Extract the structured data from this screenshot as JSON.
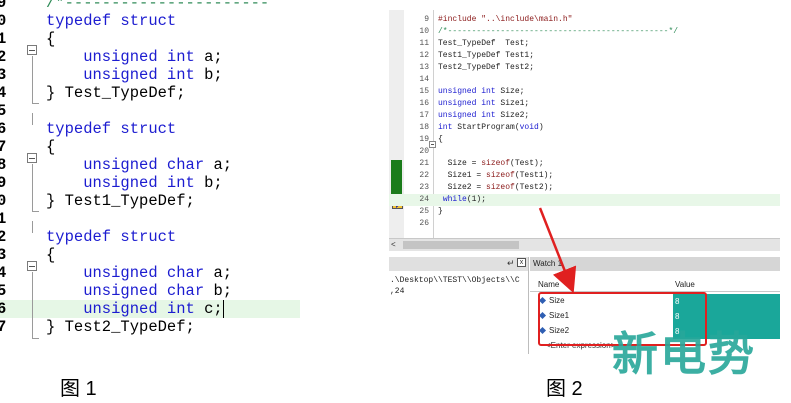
{
  "figure1": {
    "caption": "图 1",
    "lines": [
      {
        "num": "9",
        "tokens": [
          {
            "t": "/*----------------------",
            "c": "cmt"
          }
        ]
      },
      {
        "num": "0",
        "tokens": [
          {
            "t": "typedef struct",
            "c": "kw"
          }
        ]
      },
      {
        "num": "1",
        "tokens": [
          {
            "t": "{",
            "c": "tx"
          }
        ]
      },
      {
        "num": "2",
        "tokens": [
          {
            "t": "    unsigned int",
            "c": "kw"
          },
          {
            "t": " a;",
            "c": "tx"
          }
        ]
      },
      {
        "num": "3",
        "tokens": [
          {
            "t": "    unsigned int",
            "c": "kw"
          },
          {
            "t": " b;",
            "c": "tx"
          }
        ]
      },
      {
        "num": "4",
        "tokens": [
          {
            "t": "} Test_TypeDef;",
            "c": "tx"
          }
        ]
      },
      {
        "num": "5",
        "tokens": [
          {
            "t": "",
            "c": "tx"
          }
        ]
      },
      {
        "num": "6",
        "tokens": [
          {
            "t": "typedef struct",
            "c": "kw"
          }
        ]
      },
      {
        "num": "7",
        "tokens": [
          {
            "t": "{",
            "c": "tx"
          }
        ]
      },
      {
        "num": "8",
        "tokens": [
          {
            "t": "    unsigned char",
            "c": "kw"
          },
          {
            "t": " a;",
            "c": "tx"
          }
        ]
      },
      {
        "num": "9",
        "tokens": [
          {
            "t": "    unsigned int",
            "c": "kw"
          },
          {
            "t": " b;",
            "c": "tx"
          }
        ]
      },
      {
        "num": "0",
        "tokens": [
          {
            "t": "} Test1_TypeDef;",
            "c": "tx"
          }
        ]
      },
      {
        "num": "1",
        "tokens": [
          {
            "t": "",
            "c": "tx"
          }
        ]
      },
      {
        "num": "2",
        "tokens": [
          {
            "t": "typedef struct",
            "c": "kw"
          }
        ]
      },
      {
        "num": "3",
        "tokens": [
          {
            "t": "{",
            "c": "tx"
          }
        ]
      },
      {
        "num": "4",
        "tokens": [
          {
            "t": "    unsigned char",
            "c": "kw"
          },
          {
            "t": " a;",
            "c": "tx"
          }
        ]
      },
      {
        "num": "5",
        "tokens": [
          {
            "t": "    unsigned char",
            "c": "kw"
          },
          {
            "t": " b;",
            "c": "tx"
          }
        ]
      },
      {
        "num": "6",
        "tokens": [
          {
            "t": "    unsigned int",
            "c": "kw"
          },
          {
            "t": " c;",
            "c": "tx"
          }
        ],
        "highlight": true
      },
      {
        "num": "7",
        "tokens": [
          {
            "t": "} Test2_TypeDef;",
            "c": "tx"
          }
        ]
      }
    ]
  },
  "figure2": {
    "caption": "图 2",
    "editor_lines": [
      {
        "num": "9",
        "tokens": [
          {
            "t": "#include ",
            "c": "pp"
          },
          {
            "t": "\"..\\include\\main.h\"",
            "c": "str"
          }
        ]
      },
      {
        "num": "10",
        "tokens": [
          {
            "t": "/*----------------------------------------------*/",
            "c": "cmt"
          }
        ]
      },
      {
        "num": "11",
        "tokens": [
          {
            "t": "Test_TypeDef  Test;",
            "c": "tx"
          }
        ]
      },
      {
        "num": "12",
        "tokens": [
          {
            "t": "Test1_TypeDef Test1;",
            "c": "tx"
          }
        ]
      },
      {
        "num": "13",
        "tokens": [
          {
            "t": "Test2_TypeDef Test2;",
            "c": "tx"
          }
        ]
      },
      {
        "num": "14",
        "tokens": [
          {
            "t": "",
            "c": "tx"
          }
        ]
      },
      {
        "num": "15",
        "tokens": [
          {
            "t": "unsigned int",
            "c": "kw"
          },
          {
            "t": " Size;",
            "c": "tx"
          }
        ]
      },
      {
        "num": "16",
        "tokens": [
          {
            "t": "unsigned int",
            "c": "kw"
          },
          {
            "t": " Size1;",
            "c": "tx"
          }
        ]
      },
      {
        "num": "17",
        "tokens": [
          {
            "t": "unsigned int",
            "c": "kw"
          },
          {
            "t": " Size2;",
            "c": "tx"
          }
        ]
      },
      {
        "num": "18",
        "tokens": [
          {
            "t": "int",
            "c": "kw"
          },
          {
            "t": " StartProgram(",
            "c": "tx"
          },
          {
            "t": "void",
            "c": "kw"
          },
          {
            "t": ")",
            "c": "tx"
          }
        ]
      },
      {
        "num": "19",
        "tokens": [
          {
            "t": "{",
            "c": "tx"
          }
        ]
      },
      {
        "num": "20",
        "tokens": [
          {
            "t": "",
            "c": "tx"
          }
        ]
      },
      {
        "num": "21",
        "tokens": [
          {
            "t": "  Size = ",
            "c": "tx"
          },
          {
            "t": "sizeof",
            "c": "fn"
          },
          {
            "t": "(Test);",
            "c": "tx"
          }
        ]
      },
      {
        "num": "22",
        "tokens": [
          {
            "t": "  Size1 = ",
            "c": "tx"
          },
          {
            "t": "sizeof",
            "c": "fn"
          },
          {
            "t": "(Test1);",
            "c": "tx"
          }
        ]
      },
      {
        "num": "23",
        "tokens": [
          {
            "t": "  Size2 = ",
            "c": "tx"
          },
          {
            "t": "sizeof",
            "c": "fn"
          },
          {
            "t": "(Test2);",
            "c": "tx"
          }
        ]
      },
      {
        "num": "24",
        "tokens": [
          {
            "t": " ",
            "c": "tx"
          },
          {
            "t": "while",
            "c": "kw"
          },
          {
            "t": "(1);",
            "c": "tx"
          }
        ],
        "highlight": true
      },
      {
        "num": "25",
        "tokens": [
          {
            "t": "}",
            "c": "tx"
          }
        ]
      },
      {
        "num": "26",
        "tokens": [
          {
            "t": "",
            "c": "tx"
          }
        ]
      }
    ],
    "scroll_left": "<",
    "output_pane": {
      "pin_icon": "↵",
      "close_label": "x",
      "lines": [
        ".\\Desktop\\\\TEST\\\\Objects\\\\C",
        ",24"
      ]
    },
    "watch": {
      "title": "Watch 1",
      "col_name": "Name",
      "col_value": "Value",
      "rows": [
        {
          "name": "Size",
          "value": "8"
        },
        {
          "name": "Size1",
          "value": "8"
        },
        {
          "name": "Size2",
          "value": "8"
        }
      ],
      "enter_expression": "<Enter expression>"
    }
  },
  "watermark": "新电势",
  "colors": {
    "keyword": "#1c1cd0",
    "comment": "#2e8b57",
    "highlight_row": "#e6f7e6",
    "watch_value_bg": "#1aa79a",
    "annotation_red": "#e02020",
    "gutter_marker": "#1a7c1a"
  }
}
